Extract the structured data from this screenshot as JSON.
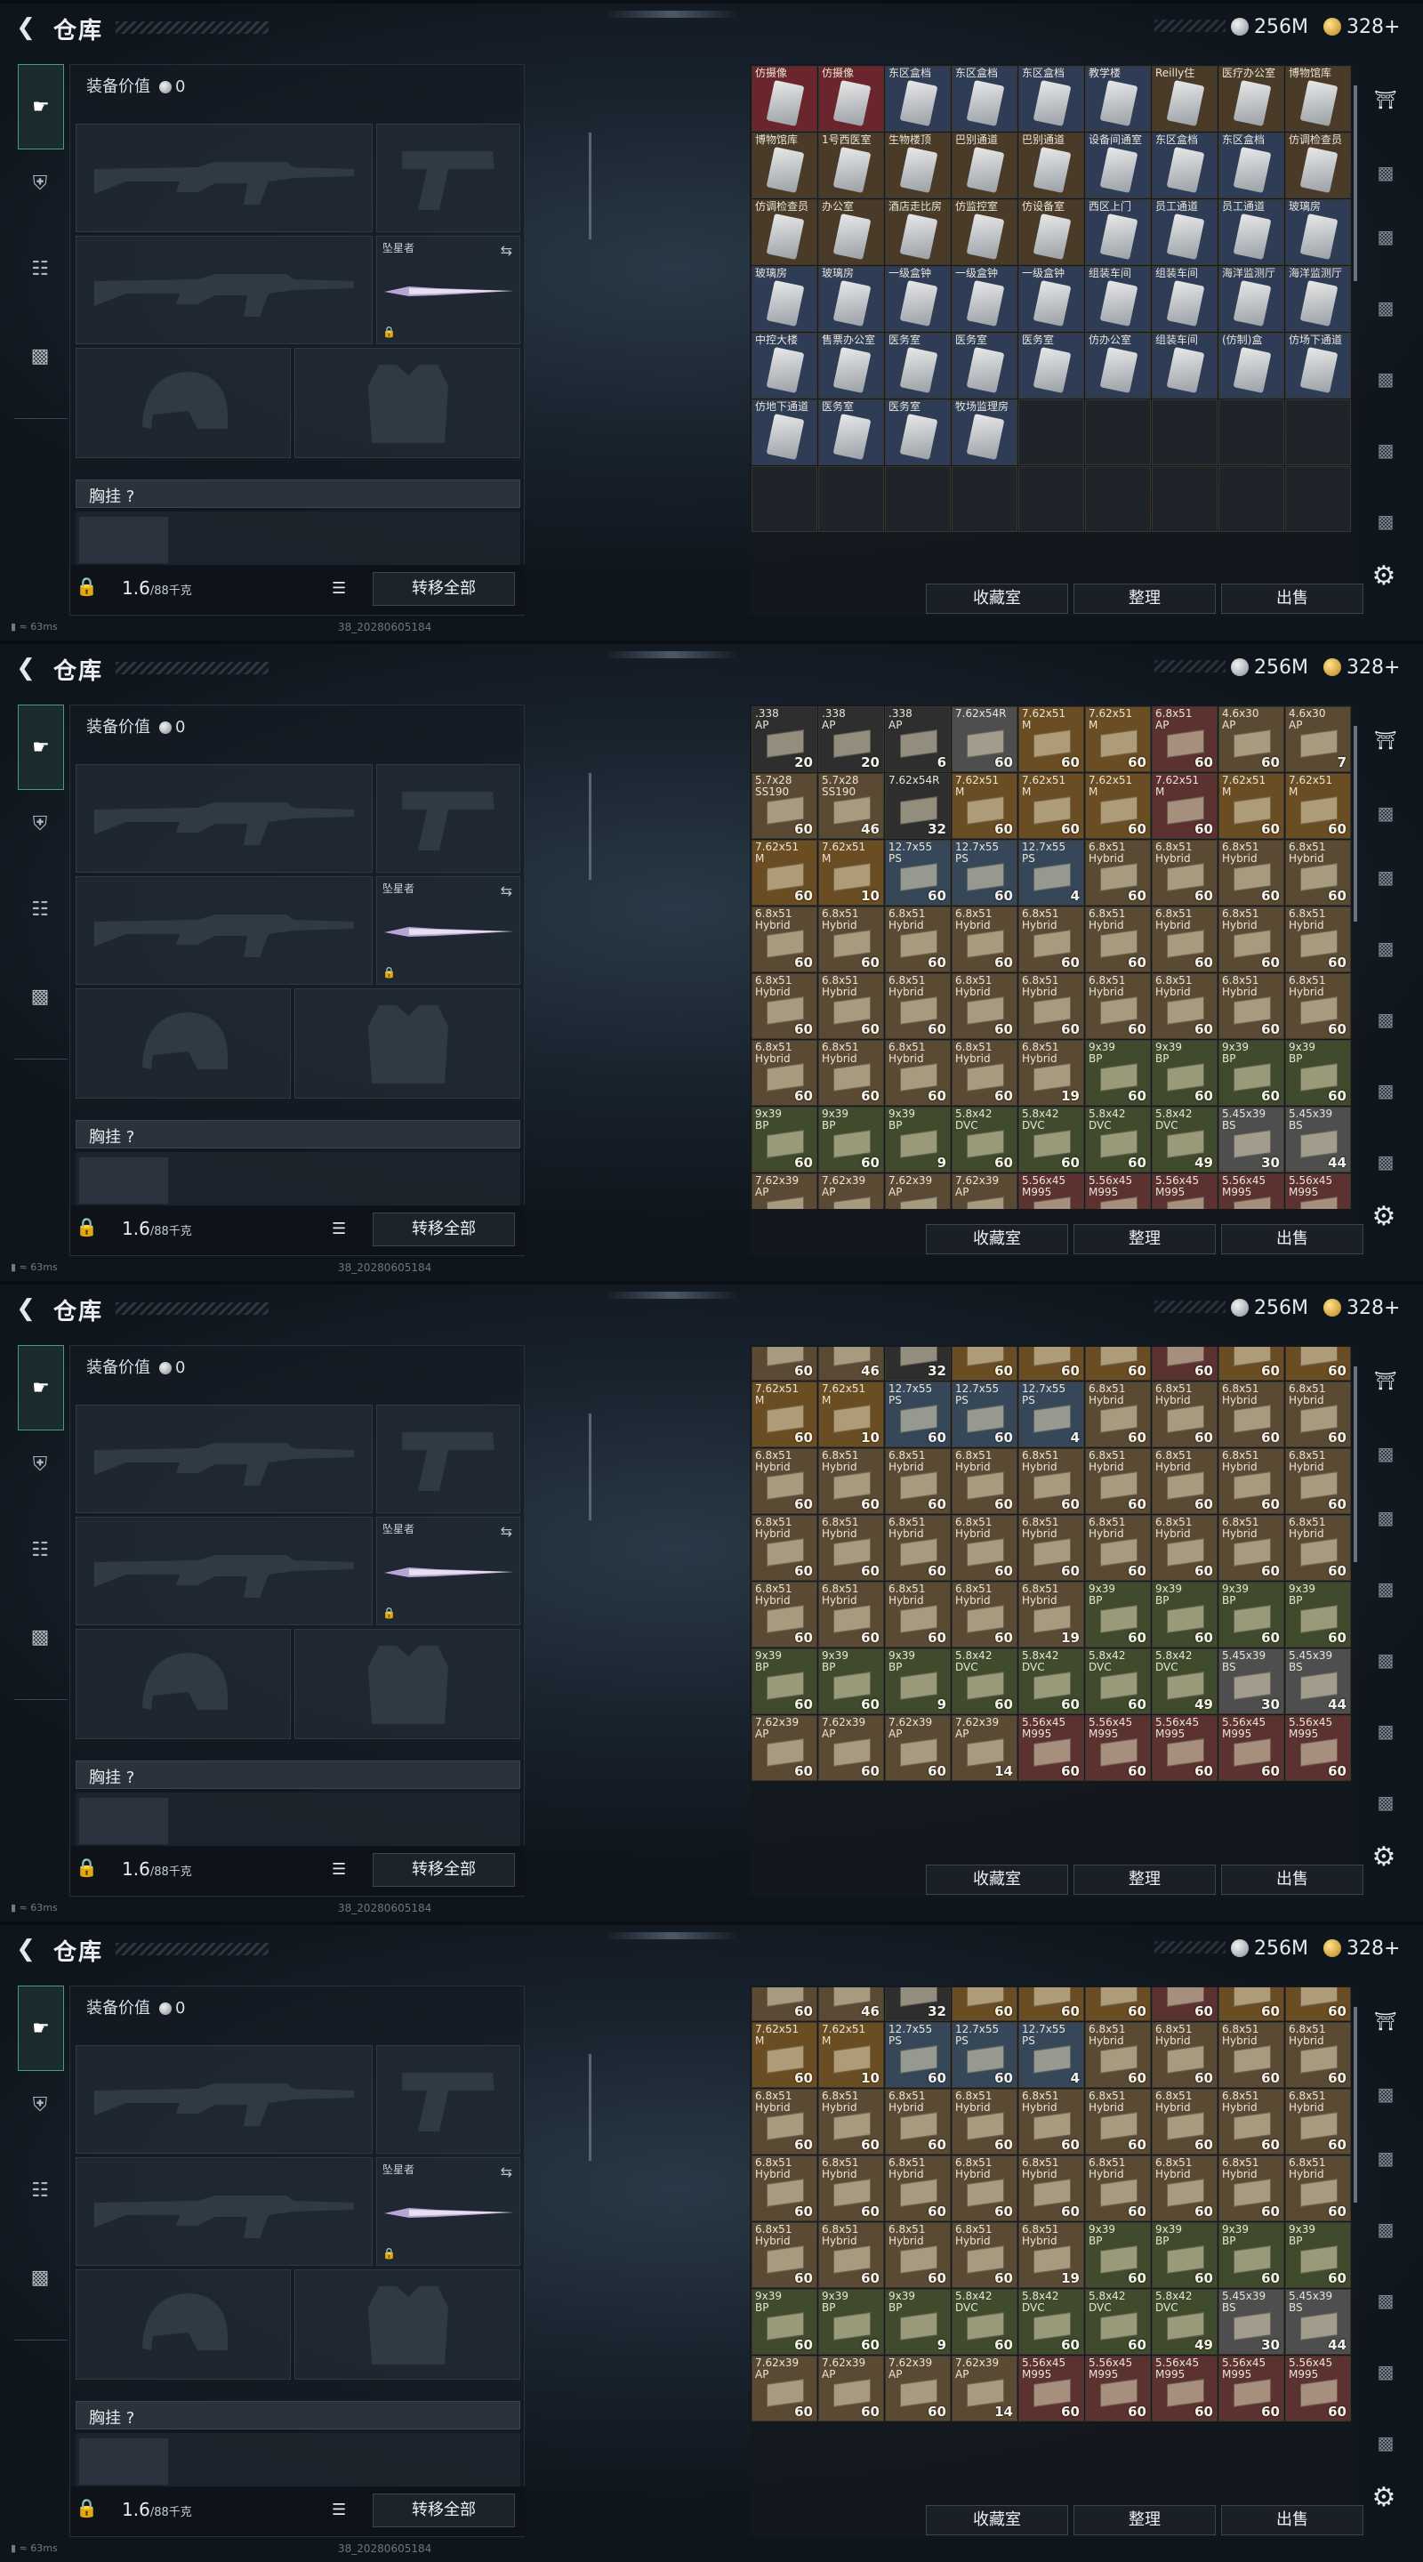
{
  "header": {
    "title": "仓库",
    "currency_silver": "256M",
    "currency_gold": "328+"
  },
  "status": {
    "ping": "63ms",
    "build": "38_20280605184"
  },
  "loadout": {
    "value_label": "装备价值",
    "value": "0",
    "knife_label": "坠星者",
    "chest_label": "胸挂",
    "chest_hint": "?",
    "weight": "1.6",
    "weight_max": "/88千克",
    "transfer_label": "转移全部"
  },
  "stash": {
    "btn_collect": "收藏室",
    "btn_sort": "整理",
    "btn_sell": "出售"
  },
  "colors": {
    "accent_green": "#3ea27a",
    "item_red": "#5a2228",
    "item_blue": "#2c3b54",
    "item_brown": "#4a3b28",
    "ammo_cell": "#4b3a27"
  },
  "frames": [
    {
      "cols": 9,
      "offset_rows": 0,
      "cells": [
        [
          "仿摄像",
          "",
          "red"
        ],
        [
          "仿摄像",
          "",
          "red"
        ],
        [
          "东区盒档",
          "",
          "blue"
        ],
        [
          "东区盒档",
          "",
          "blue"
        ],
        [
          "东区盒档",
          "",
          "blue"
        ],
        [
          "教学楼",
          "",
          "blue"
        ],
        [
          "Reilly住",
          "",
          "brown"
        ],
        [
          "医疗办公室",
          "",
          "brown"
        ],
        [
          "博物馆库",
          "",
          "brown"
        ],
        [
          "博物馆库",
          "",
          "brown"
        ],
        [
          "1号西医室",
          "",
          "brown"
        ],
        [
          "生物楼顶",
          "",
          "brown"
        ],
        [
          "巴别通道",
          "",
          "brown"
        ],
        [
          "巴别通道",
          "",
          "brown"
        ],
        [
          "设备间通室",
          "",
          "blue"
        ],
        [
          "东区盒档",
          "",
          "blue"
        ],
        [
          "东区盒档",
          "",
          "blue"
        ],
        [
          "仿调检查员",
          "",
          "brown"
        ],
        [
          "仿调检查员",
          "",
          "brown"
        ],
        [
          "办公室",
          "",
          "brown"
        ],
        [
          "酒店走比房",
          "",
          "brown"
        ],
        [
          "仿监控室",
          "",
          "brown"
        ],
        [
          "仿设备室",
          "",
          "brown"
        ],
        [
          "西区上门",
          "",
          "blue"
        ],
        [
          "员工通道",
          "",
          "blue"
        ],
        [
          "员工通道",
          "",
          "blue"
        ],
        [
          "玻璃房",
          "",
          "blue"
        ],
        [
          "玻璃房",
          "",
          "blue"
        ],
        [
          "玻璃房",
          "",
          "blue"
        ],
        [
          "一级盒钟",
          "",
          "blue"
        ],
        [
          "一级盒钟",
          "",
          "blue"
        ],
        [
          "一级盒钟",
          "",
          "blue"
        ],
        [
          "组装车间",
          "",
          "blue"
        ],
        [
          "组装车间",
          "",
          "blue"
        ],
        [
          "海洋监测厅",
          "",
          "blue"
        ],
        [
          "海洋监测厅",
          "",
          "blue"
        ],
        [
          "中控大楼",
          "",
          "blue"
        ],
        [
          "售票办公室",
          "",
          "blue"
        ],
        [
          "医务室",
          "",
          "blue"
        ],
        [
          "医务室",
          "",
          "blue"
        ],
        [
          "医务室",
          "",
          "blue"
        ],
        [
          "仿办公室",
          "",
          "blue"
        ],
        [
          "组装车间",
          "",
          "blue"
        ],
        [
          "(仿制)盒",
          "",
          "blue"
        ],
        [
          "仿场下通道",
          "",
          "blue"
        ],
        [
          "仿地下通道",
          "",
          "blue"
        ],
        [
          "医务室",
          "",
          "blue"
        ],
        [
          "医务室",
          "",
          "blue"
        ],
        [
          "牧场监理房",
          "",
          "blue"
        ],
        [
          "",
          "",
          ""
        ],
        [
          "",
          "",
          ""
        ],
        [
          "",
          "",
          ""
        ],
        [
          "",
          "",
          ""
        ],
        [
          "",
          "",
          ""
        ],
        [
          "",
          "",
          ""
        ],
        [
          "",
          "",
          ""
        ],
        [
          "",
          "",
          ""
        ],
        [
          "",
          "",
          ""
        ],
        [
          "",
          "",
          ""
        ],
        [
          "",
          "",
          ""
        ],
        [
          "",
          "",
          ""
        ],
        [
          "",
          "",
          ""
        ],
        [
          "",
          "",
          ""
        ]
      ]
    },
    {
      "cols": 9,
      "offset_rows": 0,
      "cells": [
        [
          ".338 AP",
          "20",
          "dark"
        ],
        [
          ".338 AP",
          "20",
          "dark"
        ],
        [
          ".338 AP",
          "6",
          "dark"
        ],
        [
          "7.62x54R",
          "60",
          "white"
        ],
        [
          "7.62x51 M",
          "60",
          "gold"
        ],
        [
          "7.62x51 M",
          "60",
          "gold"
        ],
        [
          "6.8x51 AP",
          "60",
          "red"
        ],
        [
          "4.6x30 AP",
          "60",
          "tan"
        ],
        [
          "4.6x30 AP",
          "7",
          "tan"
        ],
        [
          "5.7x28 SS190",
          "60",
          "tan"
        ],
        [
          "5.7x28 SS190",
          "46",
          "tan"
        ],
        [
          "7.62x54R",
          "32",
          "dark"
        ],
        [
          "7.62x51 M",
          "60",
          "gold"
        ],
        [
          "7.62x51 M",
          "60",
          "gold"
        ],
        [
          "7.62x51 M",
          "60",
          "gold"
        ],
        [
          "7.62x51 M",
          "60",
          "red"
        ],
        [
          "7.62x51 M",
          "60",
          "gold"
        ],
        [
          "7.62x51 M",
          "60",
          "gold"
        ],
        [
          "7.62x51 M",
          "60",
          "gold"
        ],
        [
          "7.62x51 M",
          "10",
          "gold"
        ],
        [
          "12.7x55 PS",
          "60",
          "blue"
        ],
        [
          "12.7x55 PS",
          "60",
          "blue"
        ],
        [
          "12.7x55 PS",
          "4",
          "blue"
        ],
        [
          "6.8x51 Hybrid",
          "60",
          "tan"
        ],
        [
          "6.8x51 Hybrid",
          "60",
          "tan"
        ],
        [
          "6.8x51 Hybrid",
          "60",
          "tan"
        ],
        [
          "6.8x51 Hybrid",
          "60",
          "tan"
        ],
        [
          "6.8x51 Hybrid",
          "60",
          "tan"
        ],
        [
          "6.8x51 Hybrid",
          "60",
          "tan"
        ],
        [
          "6.8x51 Hybrid",
          "60",
          "tan"
        ],
        [
          "6.8x51 Hybrid",
          "60",
          "tan"
        ],
        [
          "6.8x51 Hybrid",
          "60",
          "tan"
        ],
        [
          "6.8x51 Hybrid",
          "60",
          "tan"
        ],
        [
          "6.8x51 Hybrid",
          "60",
          "tan"
        ],
        [
          "6.8x51 Hybrid",
          "60",
          "tan"
        ],
        [
          "6.8x51 Hybrid",
          "60",
          "tan"
        ],
        [
          "6.8x51 Hybrid",
          "60",
          "tan"
        ],
        [
          "6.8x51 Hybrid",
          "60",
          "tan"
        ],
        [
          "6.8x51 Hybrid",
          "60",
          "tan"
        ],
        [
          "6.8x51 Hybrid",
          "60",
          "tan"
        ],
        [
          "6.8x51 Hybrid",
          "60",
          "tan"
        ],
        [
          "6.8x51 Hybrid",
          "60",
          "tan"
        ],
        [
          "6.8x51 Hybrid",
          "60",
          "tan"
        ],
        [
          "6.8x51 Hybrid",
          "60",
          "tan"
        ],
        [
          "6.8x51 Hybrid",
          "60",
          "tan"
        ],
        [
          "6.8x51 Hybrid",
          "60",
          "tan"
        ],
        [
          "6.8x51 Hybrid",
          "60",
          "tan"
        ],
        [
          "6.8x51 Hybrid",
          "60",
          "tan"
        ],
        [
          "6.8x51 Hybrid",
          "60",
          "tan"
        ],
        [
          "6.8x51 Hybrid",
          "19",
          "tan"
        ],
        [
          "9x39 BP",
          "60",
          "green"
        ],
        [
          "9x39 BP",
          "60",
          "green"
        ],
        [
          "9x39 BP",
          "60",
          "green"
        ],
        [
          "9x39 BP",
          "60",
          "green"
        ],
        [
          "9x39 BP",
          "60",
          "green"
        ],
        [
          "9x39 BP",
          "60",
          "green"
        ],
        [
          "9x39 BP",
          "9",
          "green"
        ],
        [
          "5.8x42 DVC",
          "60",
          "green"
        ],
        [
          "5.8x42 DVC",
          "60",
          "green"
        ],
        [
          "5.8x42 DVC",
          "60",
          "green"
        ],
        [
          "5.8x42 DVC",
          "49",
          "green"
        ],
        [
          "5.45x39 BS",
          "30",
          "white"
        ],
        [
          "5.45x39 BS",
          "44",
          "white"
        ],
        [
          "7.62x39 AP",
          "60",
          "tan"
        ],
        [
          "7.62x39 AP",
          "60",
          "tan"
        ],
        [
          "7.62x39 AP",
          "60",
          "tan"
        ],
        [
          "7.62x39 AP",
          "14",
          "tan"
        ],
        [
          "5.56x45 M995",
          "60",
          "red"
        ],
        [
          "5.56x45 M995",
          "60",
          "red"
        ],
        [
          "5.56x45 M995",
          "60",
          "red"
        ],
        [
          "5.56x45 M995",
          "60",
          "red"
        ],
        [
          "5.56x45 M995",
          "60",
          "red"
        ]
      ]
    },
    {
      "cols": 9,
      "offset_rows": 1,
      "cells": []
    },
    {
      "cols": 9,
      "offset_rows": 1,
      "cells": []
    }
  ]
}
